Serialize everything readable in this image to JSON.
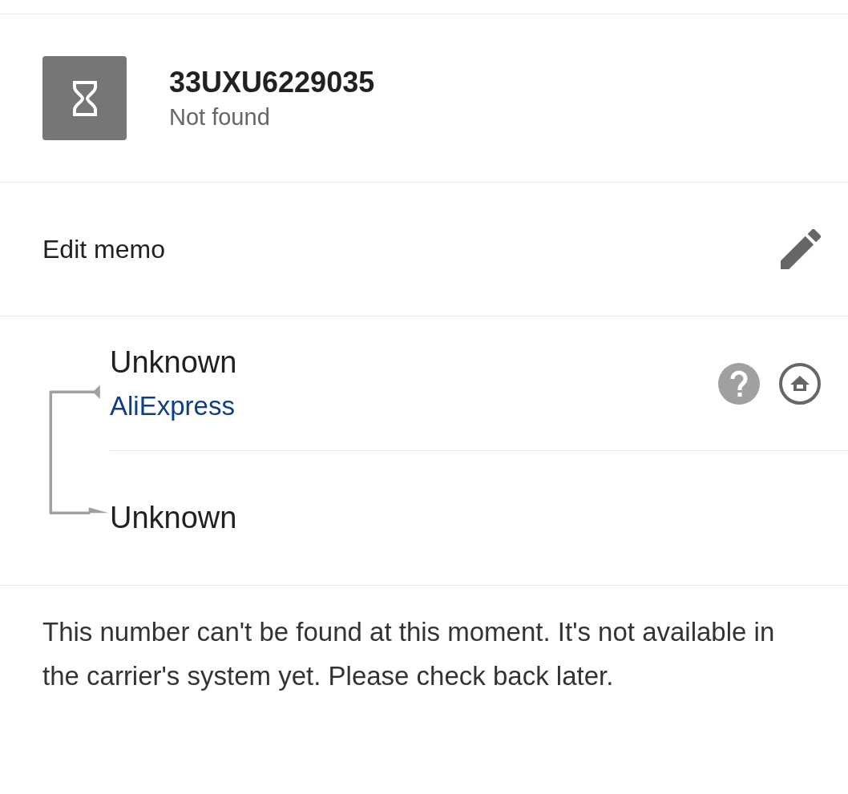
{
  "tracking": {
    "number": "33UXU6229035",
    "status": "Not found"
  },
  "memo": {
    "label": "Edit memo"
  },
  "route": {
    "origin": "Unknown",
    "carrier": "AliExpress",
    "destination": "Unknown"
  },
  "message": "This number can't be found at this moment. It's not available in the carrier's system yet. Please check back later."
}
